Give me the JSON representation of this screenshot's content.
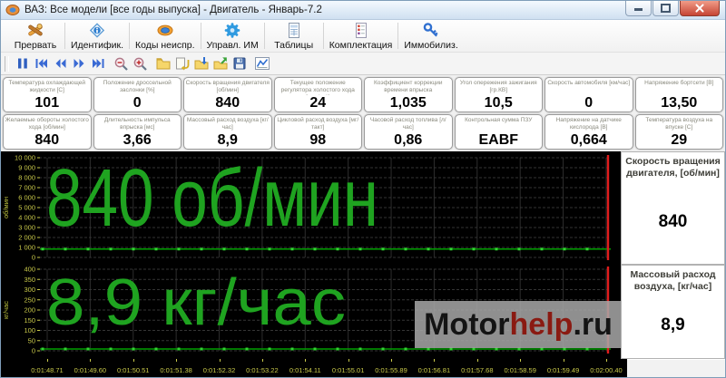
{
  "window": {
    "title": "ВАЗ: Все модели [все годы выпуска] - Двигатель - Январь-7.2"
  },
  "toolbar": {
    "buttons": [
      {
        "id": "abort",
        "icon": "abort-icon",
        "label": "Прервать"
      },
      {
        "id": "identify",
        "icon": "identify-icon",
        "label": "Идентифик."
      },
      {
        "id": "dtc",
        "icon": "dtc-icon",
        "label": "Коды неиспр."
      },
      {
        "id": "actuators",
        "icon": "actuators-icon",
        "label": "Управл. ИМ"
      },
      {
        "id": "tables",
        "icon": "tables-icon",
        "label": "Таблицы"
      },
      {
        "id": "equipment",
        "icon": "equipment-icon",
        "label": "Комплектация"
      },
      {
        "id": "immobilizer",
        "icon": "immobilizer-icon",
        "label": "Иммобилиз."
      }
    ]
  },
  "quick_toolbar": {
    "icons": [
      "pause-icon",
      "go-first-icon",
      "step-back-icon",
      "step-forward-icon",
      "go-last-icon",
      "zoom-out-icon",
      "zoom-in-icon",
      "folder-icon",
      "paste-icon",
      "import-icon",
      "export-icon",
      "save-icon",
      "graph-icon"
    ]
  },
  "parameters": {
    "rows": [
      [
        {
          "label": "Температура охлаждающей жидкости [C]",
          "value": "101"
        },
        {
          "label": "Положение дроссельной заслонки [%]",
          "value": "0"
        },
        {
          "label": "Скорость вращения двигателя [об/мин]",
          "value": "840"
        },
        {
          "label": "Текущее положение регулятора холостого хода [шаг(ов)]",
          "value": "24"
        },
        {
          "label": "Коэффициент коррекции времени впрыска",
          "value": "1,035"
        },
        {
          "label": "Угол опережения зажигания [гр.КВ]",
          "value": "10,5"
        },
        {
          "label": "Скорость автомобиля [км/час]",
          "value": "0"
        },
        {
          "label": "Напряжение бортсети [В]",
          "value": "13,50"
        }
      ],
      [
        {
          "label": "Желаемые обороты холостого хода [об/мин]",
          "value": "840"
        },
        {
          "label": "Длительность импульса впрыска [мс]",
          "value": "3,66"
        },
        {
          "label": "Массовый расход воздуха [кг/час]",
          "value": "8,9"
        },
        {
          "label": "Цикловой расход воздуха [мг/такт]",
          "value": "98"
        },
        {
          "label": "Часовой расход топлива [л/час]",
          "value": "0,86"
        },
        {
          "label": "Контрольная сумма ПЗУ",
          "value": "EABF"
        },
        {
          "label": "Напряжение на датчике кислорода [В]",
          "value": "0,664"
        },
        {
          "label": "Температура воздуха на впуске [C]",
          "value": "29"
        }
      ]
    ]
  },
  "time_axis": {
    "labels": [
      "0:01:48.71",
      "0:01:49.60",
      "0:01:50.51",
      "0:01:51.38",
      "0:01:52.32",
      "0:01:53.22",
      "0:01:54.11",
      "0:01:55.01",
      "0:01:55.89",
      "0:01:56.81",
      "0:01:57.68",
      "0:01:58.59",
      "0:01:59.49",
      "0:02:00.40"
    ],
    "color": "#c9c94a"
  },
  "chart_data": [
    {
      "type": "line",
      "name": "engine-speed",
      "overlay_text": "840 об/мин",
      "ylabel": "об/мин",
      "ylim": [
        0,
        10000
      ],
      "ytick_labels": [
        "10 000",
        "9 000",
        "8 000",
        "7 000",
        "6 000",
        "5 000",
        "4 000",
        "3 000",
        "2 000",
        "1 000",
        "0"
      ],
      "x": [
        "0:01:48.71",
        "0:01:49.60",
        "0:01:50.51",
        "0:01:51.38",
        "0:01:52.32",
        "0:01:53.22",
        "0:01:54.11",
        "0:01:55.01",
        "0:01:55.89",
        "0:01:56.81",
        "0:01:57.68",
        "0:01:58.59",
        "0:01:59.49",
        "0:02:00.40"
      ],
      "values": [
        840,
        840,
        840,
        840,
        840,
        840,
        840,
        840,
        840,
        840,
        840,
        840,
        840,
        840
      ],
      "current_value": 840,
      "grid": true,
      "line_color": "#00a000",
      "marker_color": "#35d435",
      "overlay_color": "#1fa320",
      "tick_color": "#c9c94a",
      "cursor_color": "#e01c1c",
      "panel": {
        "label": "Скорость вращения двигателя, [об/мин]",
        "value": "840"
      }
    },
    {
      "type": "line",
      "name": "mass-air-flow",
      "overlay_text": "8,9 кг/час",
      "ylabel": "кг/час",
      "ylim": [
        0,
        400
      ],
      "ytick_labels": [
        "400",
        "350",
        "300",
        "250",
        "200",
        "150",
        "100",
        "50",
        "0"
      ],
      "x": [
        "0:01:48.71",
        "0:01:49.60",
        "0:01:50.51",
        "0:01:51.38",
        "0:01:52.32",
        "0:01:53.22",
        "0:01:54.11",
        "0:01:55.01",
        "0:01:55.89",
        "0:01:56.81",
        "0:01:57.68",
        "0:01:58.59",
        "0:01:59.49",
        "0:02:00.40"
      ],
      "values": [
        8.9,
        8.9,
        8.9,
        8.9,
        8.9,
        8.9,
        8.9,
        8.9,
        8.9,
        8.9,
        8.9,
        8.9,
        8.9,
        8.9
      ],
      "current_value": 8.9,
      "grid": true,
      "line_color": "#00a000",
      "marker_color": "#35d435",
      "overlay_color": "#1fa320",
      "tick_color": "#c9c94a",
      "cursor_color": "#e01c1c",
      "panel": {
        "label": "Массовый расход воздуха, [кг/час]",
        "value": "8,9"
      },
      "watermark": {
        "segments": [
          {
            "text": "Motor",
            "color": "#141414"
          },
          {
            "text": "help",
            "color": "#8a1a12"
          },
          {
            "text": ".ru",
            "color": "#141414"
          }
        ]
      }
    }
  ]
}
